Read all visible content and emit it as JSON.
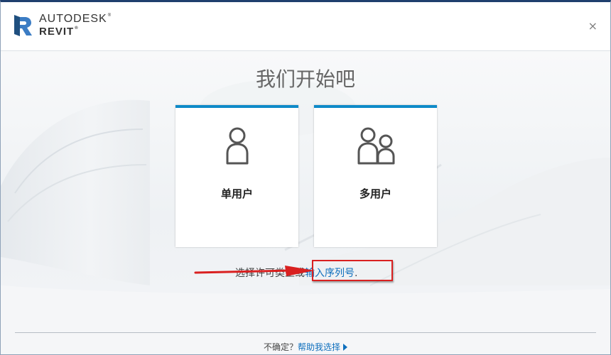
{
  "header": {
    "brand_line1": "AUTODESK",
    "brand_line2": "REVIT",
    "trademark": "®",
    "close_glyph": "×",
    "logo_icon": "revit-r-icon"
  },
  "main": {
    "title": "我们开始吧",
    "cards": [
      {
        "label": "单用户",
        "icon": "single-user-icon"
      },
      {
        "label": "多用户",
        "icon": "multi-user-icon"
      }
    ],
    "serial": {
      "prefix": "选择许可类型或",
      "link": "输入序列号",
      "suffix": "."
    }
  },
  "footer": {
    "question": "不确定？",
    "help_link": "帮助我选择",
    "chevron_icon": "triangle-right-icon"
  },
  "colors": {
    "accent": "#0e8ac8",
    "link": "#0e6fbd",
    "annotation_red": "#d92020",
    "title_bar": "#1f3f6e"
  }
}
